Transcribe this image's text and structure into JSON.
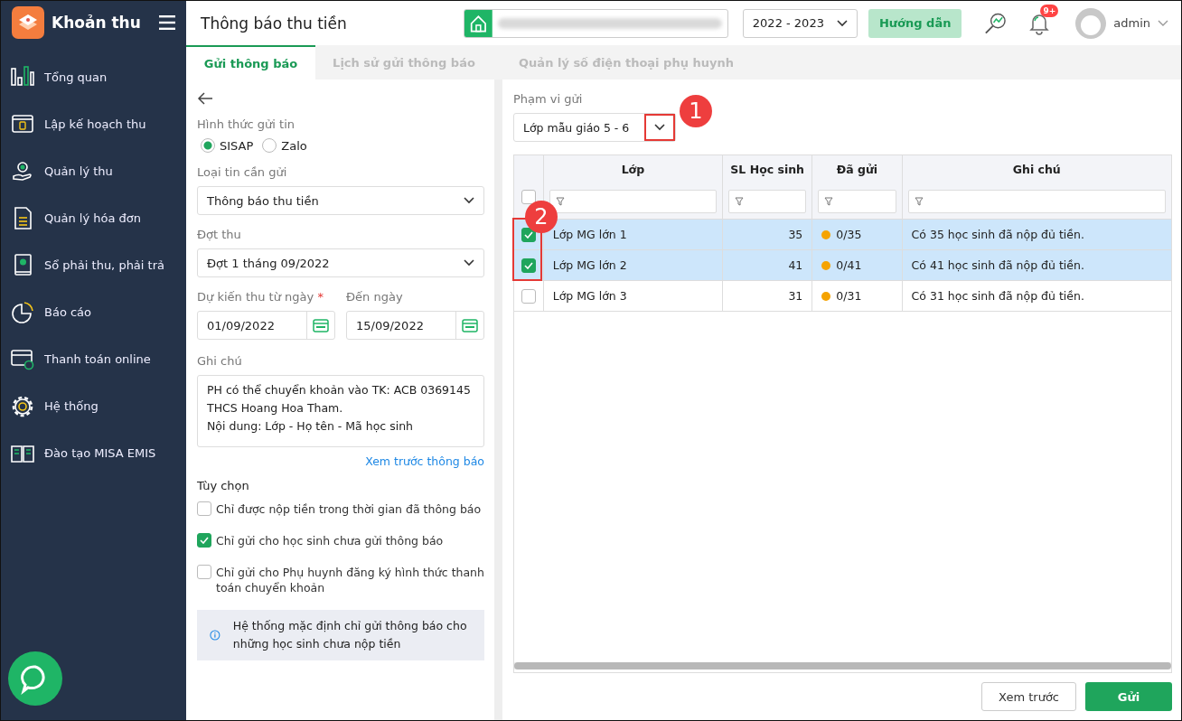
{
  "app": {
    "title": "Khoản thu"
  },
  "sidebar": {
    "items": [
      {
        "label": "Tổng quan",
        "selected": false
      },
      {
        "label": "Lập kế hoạch thu",
        "selected": false
      },
      {
        "label": "Quản lý thu",
        "selected": false
      },
      {
        "label": "Quản lý hóa đơn",
        "selected": false
      },
      {
        "label": "Sổ phải thu, phải trả",
        "selected": false
      },
      {
        "label": "Báo cáo",
        "selected": false
      },
      {
        "label": "Thanh toán online",
        "selected": false
      },
      {
        "label": "Hệ thống",
        "selected": false
      },
      {
        "label": "Đào tạo MISA EMIS",
        "selected": false
      }
    ]
  },
  "header": {
    "page_title": "Thông báo thu tiền",
    "school_year": "2022 - 2023",
    "guide_button": "Hướng dẫn",
    "notification_badge": "9+",
    "user": "admin"
  },
  "tabs": [
    {
      "label": "Gửi thông báo",
      "selected": true
    },
    {
      "label": "Lịch sử gửi thông báo",
      "selected": false
    },
    {
      "label": "Quản lý số điện thoại phụ huynh",
      "selected": false
    }
  ],
  "form": {
    "send_method": {
      "label": "Hình thức gửi tin",
      "options": [
        {
          "label": "SISAP",
          "selected": true
        },
        {
          "label": "Zalo",
          "selected": false
        }
      ]
    },
    "message_type": {
      "label": "Loại tin cần gửi",
      "value": "Thông báo thu tiền"
    },
    "period": {
      "label": "Đợt thu",
      "value": "Đợt 1 tháng 09/2022"
    },
    "from_date": {
      "label": "Dự kiến thu từ ngày",
      "required_mark": "*",
      "value": "01/09/2022"
    },
    "to_date": {
      "label": "Đến ngày",
      "value": "15/09/2022"
    },
    "note": {
      "label": "Ghi chú",
      "lines": [
        "PH có thể chuyển khoản vào TK: ACB  0369145",
        "THCS Hoang Hoa Tham.",
        "Nội dung: Lớp - Họ tên - Mã học sinh"
      ]
    },
    "preview_link": "Xem trước thông báo",
    "options_label": "Tùy chọn",
    "options": [
      {
        "label": "Chỉ được nộp tiền trong thời gian đã thông báo",
        "checked": false
      },
      {
        "label": "Chỉ gửi cho học sinh chưa gửi thông báo",
        "checked": true
      },
      {
        "label": "Chỉ gửi cho Phụ huynh đăng ký hình thức thanh toán chuyển khoản",
        "checked": false
      }
    ],
    "info": "Hệ thống mặc định chỉ gửi thông báo cho những học sinh chưa nộp tiền"
  },
  "scope": {
    "label": "Phạm vi gửi",
    "value": "Lớp mẫu giáo 5 - 6"
  },
  "table": {
    "columns": [
      "Lớp",
      "SL Học sinh",
      "Đã gửi",
      "Ghi chú"
    ],
    "all_checked": false,
    "rows": [
      {
        "class": "Lớp MG lớn 1",
        "students": "35",
        "sent": "0/35",
        "note": "Có 35 học sinh đã nộp đủ tiền.",
        "selected": true
      },
      {
        "class": "Lớp MG lớn 2",
        "students": "41",
        "sent": "0/41",
        "note": "Có 41 học sinh đã nộp đủ tiền.",
        "selected": true
      },
      {
        "class": "Lớp MG lớn 3",
        "students": "31",
        "sent": "0/31",
        "note": "Có 31 học sinh đã nộp đủ tiền.",
        "selected": false
      }
    ]
  },
  "buttons": [
    {
      "label": "Xem trước",
      "kind": "secondary"
    },
    {
      "label": "Gửi",
      "kind": "primary"
    }
  ],
  "callouts": [
    "1",
    "2"
  ]
}
